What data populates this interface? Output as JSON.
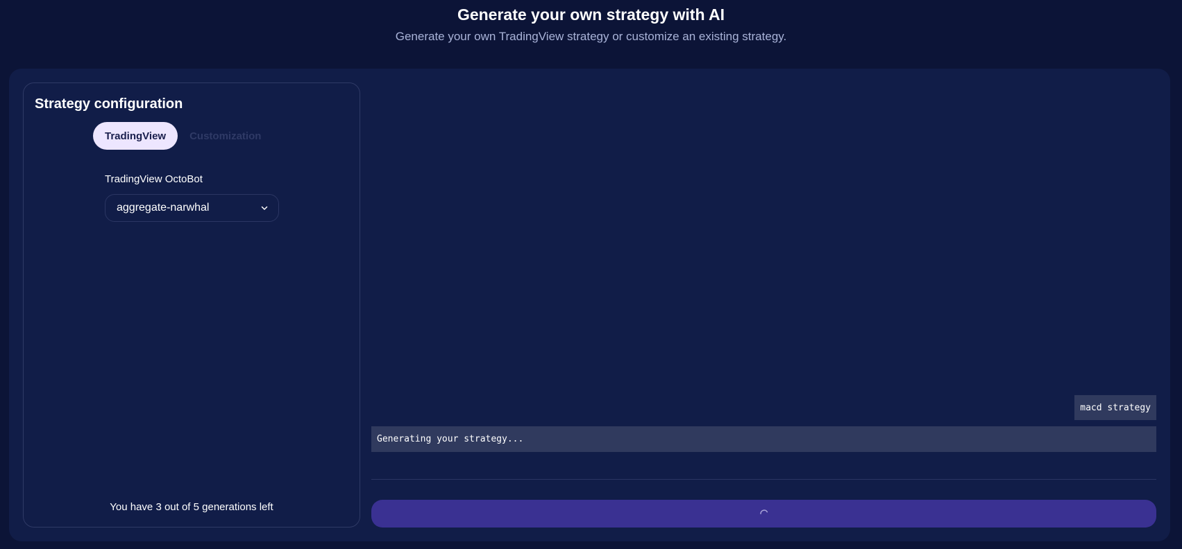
{
  "header": {
    "title": "Generate your own strategy with AI",
    "subtitle": "Generate your own TradingView strategy or customize an existing strategy."
  },
  "config": {
    "title": "Strategy configuration",
    "tabs": [
      {
        "label": "TradingView",
        "active": true
      },
      {
        "label": "Customization",
        "active": false
      }
    ],
    "field_label": "TradingView OctoBot",
    "select_value": "aggregate-narwhal",
    "select_icon": "chevron-down-icon",
    "generations_text": "You have 3 out of 5 generations left"
  },
  "chat": {
    "messages": [
      {
        "role": "user",
        "text": "macd strategy"
      },
      {
        "role": "assistant",
        "text": "Generating your strategy..."
      }
    ],
    "generate_button": {
      "loading": true,
      "icon": "spinner-icon"
    }
  },
  "colors": {
    "background": "#0c1437",
    "card": "#111d48",
    "active_tab": "#ede6ff",
    "message_bg": "#303a5e",
    "button": "#3a3192"
  }
}
